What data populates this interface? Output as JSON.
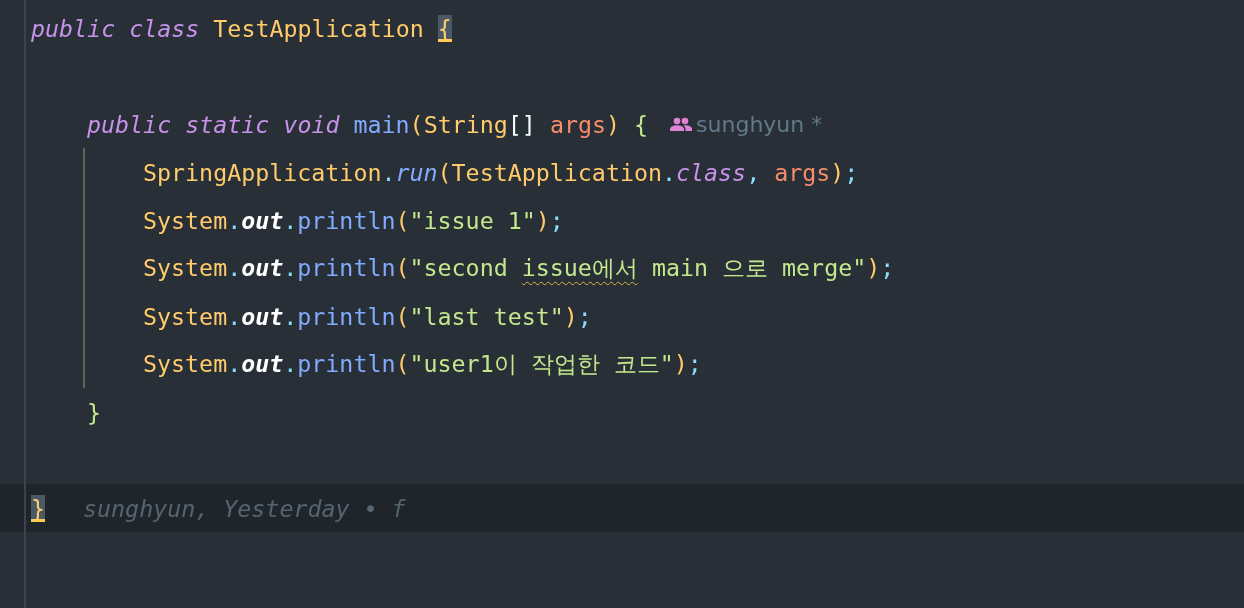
{
  "editor": {
    "lines": [
      {
        "tokens": [
          {
            "text": "public class ",
            "kind": "keyword"
          },
          {
            "text": "TestApplication ",
            "kind": "class"
          },
          {
            "text": "{",
            "kind": "brace",
            "matched": true
          }
        ],
        "current": false,
        "children": [
          {
            "kind": "blank"
          },
          {
            "tokens": [
              {
                "text": "public static void ",
                "kind": "keyword"
              },
              {
                "text": "main",
                "kind": "method"
              },
              {
                "text": "(",
                "kind": "paren"
              },
              {
                "text": "String",
                "kind": "class"
              },
              {
                "text": "[] ",
                "kind": "plain"
              },
              {
                "text": "args",
                "kind": "param"
              },
              {
                "text": ") ",
                "kind": "paren"
              },
              {
                "text": "{",
                "kind": "brace2",
                "matched": false
              }
            ],
            "current": false,
            "inlay": {
              "author": "sunghyun *"
            },
            "indent_guide": true,
            "children": [
              {
                "tokens": [
                  {
                    "text": "SpringApplication",
                    "kind": "class"
                  },
                  {
                    "text": ".",
                    "kind": "punct"
                  },
                  {
                    "text": "run",
                    "kind": "imethod"
                  },
                  {
                    "text": "(",
                    "kind": "paren"
                  },
                  {
                    "text": "TestApplication",
                    "kind": "class"
                  },
                  {
                    "text": ".",
                    "kind": "punct"
                  },
                  {
                    "text": "class",
                    "kind": "keyword"
                  },
                  {
                    "text": ", ",
                    "kind": "punct"
                  },
                  {
                    "text": "args",
                    "kind": "param"
                  },
                  {
                    "text": ")",
                    "kind": "paren"
                  },
                  {
                    "text": ";",
                    "kind": "punct"
                  }
                ],
                "current": false
              },
              {
                "tokens": [
                  {
                    "text": "System",
                    "kind": "class"
                  },
                  {
                    "text": ".",
                    "kind": "punct"
                  },
                  {
                    "text": "out",
                    "kind": "field"
                  },
                  {
                    "text": ".",
                    "kind": "punct"
                  },
                  {
                    "text": "println",
                    "kind": "method"
                  },
                  {
                    "text": "(",
                    "kind": "paren"
                  },
                  {
                    "text": "\"issue 1\"",
                    "kind": "string"
                  },
                  {
                    "text": ")",
                    "kind": "paren"
                  },
                  {
                    "text": ";",
                    "kind": "punct"
                  }
                ],
                "current": false
              },
              {
                "tokens": [
                  {
                    "text": "System",
                    "kind": "class"
                  },
                  {
                    "text": ".",
                    "kind": "punct"
                  },
                  {
                    "text": "out",
                    "kind": "field"
                  },
                  {
                    "text": ".",
                    "kind": "punct"
                  },
                  {
                    "text": "println",
                    "kind": "method"
                  },
                  {
                    "text": "(",
                    "kind": "paren"
                  },
                  {
                    "text": "\"second ",
                    "kind": "string"
                  },
                  {
                    "text": "issue에서",
                    "kind": "string",
                    "typo": true
                  },
                  {
                    "text": " main 으로 merge\"",
                    "kind": "string"
                  },
                  {
                    "text": ")",
                    "kind": "paren"
                  },
                  {
                    "text": ";",
                    "kind": "punct"
                  }
                ],
                "current": false
              },
              {
                "tokens": [
                  {
                    "text": "System",
                    "kind": "class"
                  },
                  {
                    "text": ".",
                    "kind": "punct"
                  },
                  {
                    "text": "out",
                    "kind": "field"
                  },
                  {
                    "text": ".",
                    "kind": "punct"
                  },
                  {
                    "text": "println",
                    "kind": "method"
                  },
                  {
                    "text": "(",
                    "kind": "paren"
                  },
                  {
                    "text": "\"last test\"",
                    "kind": "string"
                  },
                  {
                    "text": ")",
                    "kind": "paren"
                  },
                  {
                    "text": ";",
                    "kind": "punct"
                  }
                ],
                "current": false
              },
              {
                "tokens": [
                  {
                    "text": "System",
                    "kind": "class"
                  },
                  {
                    "text": ".",
                    "kind": "punct"
                  },
                  {
                    "text": "out",
                    "kind": "field"
                  },
                  {
                    "text": ".",
                    "kind": "punct"
                  },
                  {
                    "text": "println",
                    "kind": "method"
                  },
                  {
                    "text": "(",
                    "kind": "paren"
                  },
                  {
                    "text": "\"user1이 작업한 코드\"",
                    "kind": "string"
                  },
                  {
                    "text": ")",
                    "kind": "paren"
                  },
                  {
                    "text": ";",
                    "kind": "punct"
                  }
                ],
                "current": false
              }
            ]
          },
          {
            "tokens": [
              {
                "text": "}",
                "kind": "brace2",
                "matched": false
              }
            ],
            "current": false
          },
          {
            "kind": "blank"
          }
        ]
      },
      {
        "tokens": [
          {
            "text": "}",
            "kind": "brace",
            "matched": true
          }
        ],
        "current": true,
        "blame": "sunghyun, Yesterday • f"
      }
    ]
  }
}
